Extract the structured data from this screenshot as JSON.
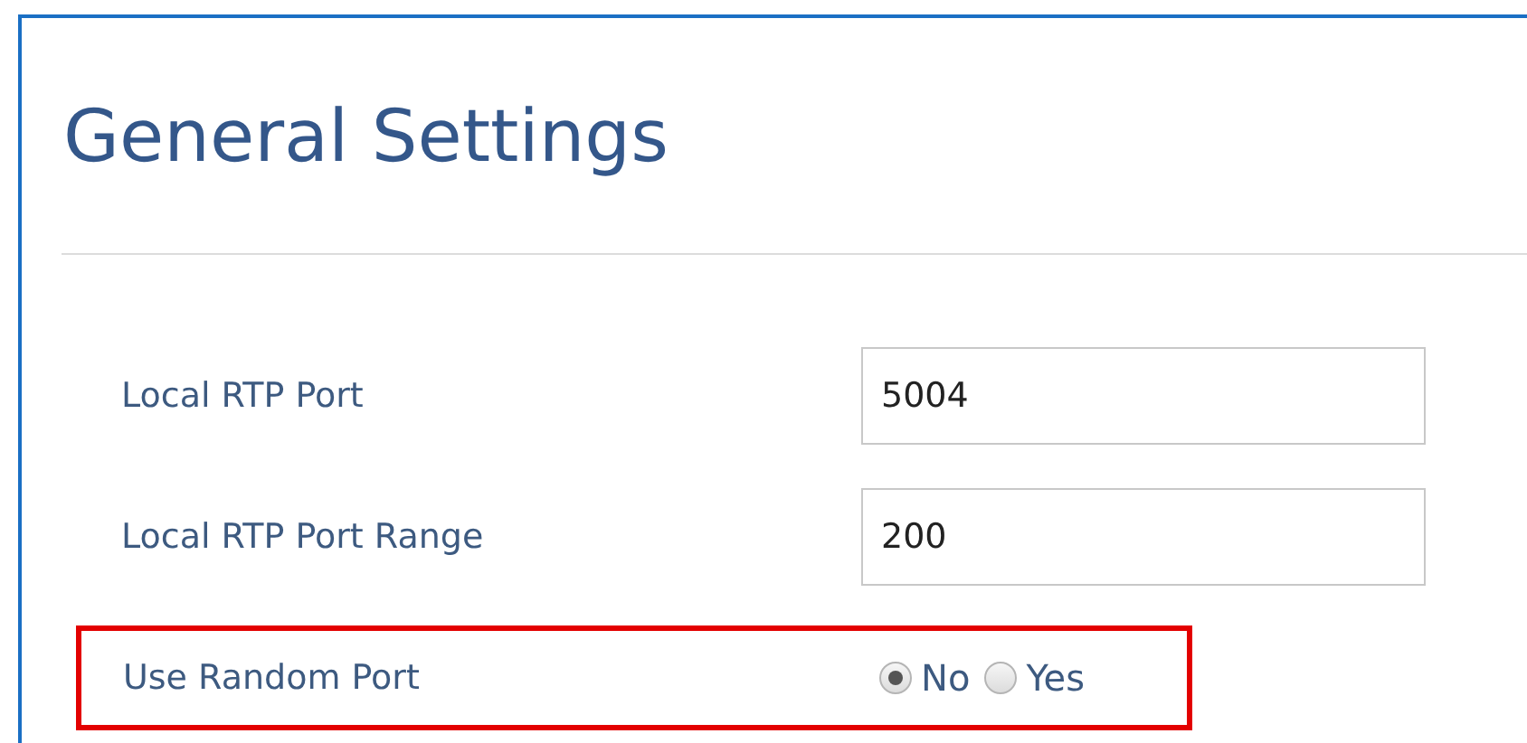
{
  "title": "General Settings",
  "fields": [
    {
      "label": "Local RTP Port",
      "value": "5004"
    },
    {
      "label": "Local RTP Port Range",
      "value": "200"
    }
  ],
  "radio_row": {
    "label": "Use Random Port",
    "highlighted": true,
    "options": [
      {
        "label": "No",
        "selected": true
      },
      {
        "label": "Yes",
        "selected": false
      }
    ]
  }
}
